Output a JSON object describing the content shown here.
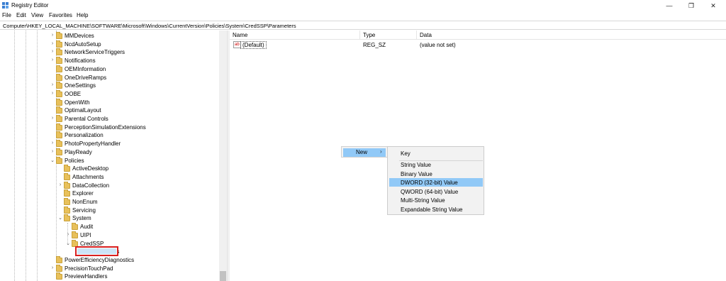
{
  "window": {
    "title": "Registry Editor",
    "controls": [
      "—",
      "❐",
      "✕"
    ]
  },
  "menu": [
    "File",
    "Edit",
    "View",
    "Favorites",
    "Help"
  ],
  "address": "Computer\\HKEY_LOCAL_MACHINE\\SOFTWARE\\Microsoft\\Windows\\CurrentVersion\\Policies\\System\\CredSSP\\Parameters",
  "tree": {
    "items": [
      {
        "label": "MMDevices",
        "chevron": "›"
      },
      {
        "label": "NcdAutoSetup",
        "chevron": "›"
      },
      {
        "label": "NetworkServiceTriggers",
        "chevron": "›"
      },
      {
        "label": "Notifications",
        "chevron": "›"
      },
      {
        "label": "OEMInformation",
        "chevron": ""
      },
      {
        "label": "OneDriveRamps",
        "chevron": ""
      },
      {
        "label": "OneSettings",
        "chevron": "›"
      },
      {
        "label": "OOBE",
        "chevron": "›"
      },
      {
        "label": "OpenWith",
        "chevron": ""
      },
      {
        "label": "OptimalLayout",
        "chevron": ""
      },
      {
        "label": "Parental Controls",
        "chevron": "›"
      },
      {
        "label": "PerceptionSimulationExtensions",
        "chevron": ""
      },
      {
        "label": "Personalization",
        "chevron": ""
      },
      {
        "label": "PhotoPropertyHandler",
        "chevron": "›"
      },
      {
        "label": "PlayReady",
        "chevron": "›"
      },
      {
        "label": "Policies",
        "chevron": "⌄"
      },
      {
        "label": "ActiveDesktop",
        "chevron": ""
      },
      {
        "label": "Attachments",
        "chevron": ""
      },
      {
        "label": "DataCollection",
        "chevron": "›"
      },
      {
        "label": "Explorer",
        "chevron": ""
      },
      {
        "label": "NonEnum",
        "chevron": ""
      },
      {
        "label": "Servicing",
        "chevron": ""
      },
      {
        "label": "System",
        "chevron": "⌄"
      },
      {
        "label": "Audit",
        "chevron": ""
      },
      {
        "label": "UIPI",
        "chevron": "›"
      },
      {
        "label": "CredSSP",
        "chevron": "⌄"
      },
      {
        "label": "Parameters",
        "chevron": ""
      },
      {
        "label": "PowerEfficiencyDiagnostics",
        "chevron": ""
      },
      {
        "label": "PrecisionTouchPad",
        "chevron": "›"
      },
      {
        "label": "PreviewHandlers",
        "chevron": ""
      }
    ]
  },
  "list": {
    "headers": {
      "name": "Name",
      "type": "Type",
      "data": "Data"
    },
    "rows": [
      {
        "icon": "ab",
        "name": "(Default)",
        "type": "REG_SZ",
        "data": "(value not set)"
      }
    ]
  },
  "context_menu": {
    "new_label": "New",
    "arrow": "›",
    "submenu": [
      "Key",
      "String Value",
      "Binary Value",
      "DWORD (32-bit) Value",
      "QWORD (64-bit) Value",
      "Multi-String Value",
      "Expandable String Value"
    ],
    "highlighted": "DWORD (32-bit) Value"
  },
  "colors": {
    "highlight": "#91c9f7",
    "selection_border": "#d92020",
    "folder": "#e8c05a"
  }
}
